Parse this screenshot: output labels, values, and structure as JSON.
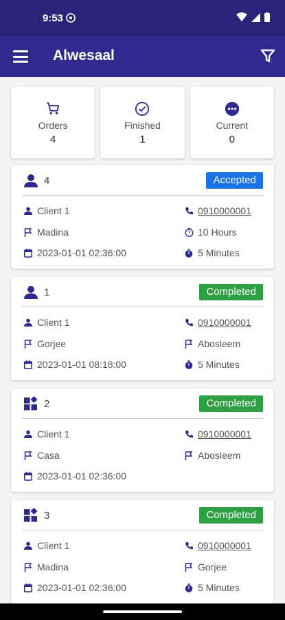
{
  "status_bar": {
    "time": "9:53"
  },
  "app_bar": {
    "title": "Alwesaal"
  },
  "stats": [
    {
      "label": "Orders",
      "count": "4",
      "icon": "cart-icon"
    },
    {
      "label": "Finished",
      "count": "1",
      "icon": "check-circle-icon"
    },
    {
      "label": "Current",
      "count": "0",
      "icon": "more-circle-icon"
    }
  ],
  "orders": [
    {
      "id": "4",
      "head_icon": "person-icon",
      "status": "Accepted",
      "status_color": "#1a73e8",
      "client": "Client 1",
      "phone": "0910000001",
      "from": "Madina",
      "right2": "10 Hours",
      "right2_icon": "timer-icon",
      "date": "2023-01-01 02:36:00",
      "right3": "5 Minutes"
    },
    {
      "id": "1",
      "head_icon": "person-icon",
      "status": "Completed",
      "status_color": "#2ea043",
      "client": "Client 1",
      "phone": "0910000001",
      "from": "Gorjee",
      "right2": "Abosleem",
      "right2_icon": "flag-icon",
      "date": "2023-01-01 08:18:00",
      "right3": "5 Minutes"
    },
    {
      "id": "2",
      "head_icon": "widgets-icon",
      "status": "Completed",
      "status_color": "#2ea043",
      "client": "Client 1",
      "phone": "0910000001",
      "from": "Casa",
      "right2": "Abosleem",
      "right2_icon": "flag-icon",
      "date": "2023-01-01 02:36:00",
      "right3": ""
    },
    {
      "id": "3",
      "head_icon": "widgets-icon",
      "status": "Completed",
      "status_color": "#2ea043",
      "client": "Client 1",
      "phone": "0910000001",
      "from": "Madina",
      "right2": "Gorjee",
      "right2_icon": "flag-icon",
      "date": "2023-01-01 02:36:00",
      "right3": "5 Minutes"
    }
  ],
  "colors": {
    "primary": "#2f2a8e",
    "status_bar": "#2a2377",
    "icon": "#2f2a8e"
  }
}
